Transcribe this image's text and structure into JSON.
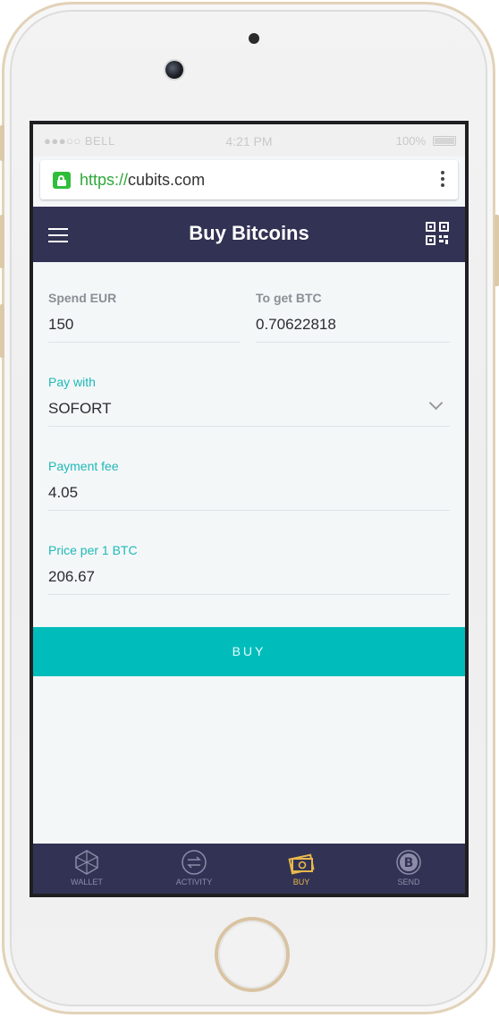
{
  "status_bar": {
    "carrier": "●●●○○ BELL",
    "time": "4:21 PM",
    "battery": "100%"
  },
  "browser": {
    "url_scheme": "https://",
    "url_host": "cubits.com"
  },
  "app_bar": {
    "title": "Buy Bitcoins"
  },
  "form": {
    "spend": {
      "label": "Spend EUR",
      "value": "150"
    },
    "get": {
      "label": "To get BTC",
      "value": "0.70622818"
    },
    "pay_with": {
      "label": "Pay with",
      "value": "SOFORT"
    },
    "payment_fee": {
      "label": "Payment fee",
      "value": "4.05"
    },
    "price": {
      "label": "Price per 1 BTC",
      "value": "206.67"
    }
  },
  "buy_button": {
    "label": "BUY"
  },
  "tabs": [
    {
      "label": "WALLET",
      "icon": "wallet-icon",
      "active": false
    },
    {
      "label": "ACTIVITY",
      "icon": "activity-icon",
      "active": false
    },
    {
      "label": "BUY",
      "icon": "buy-icon",
      "active": true
    },
    {
      "label": "SEND",
      "icon": "send-icon",
      "active": false
    }
  ],
  "colors": {
    "header": "#323254",
    "accent": "#00bdbb",
    "active_tab": "#e8b94a",
    "secure_green": "#2fbe3a"
  }
}
